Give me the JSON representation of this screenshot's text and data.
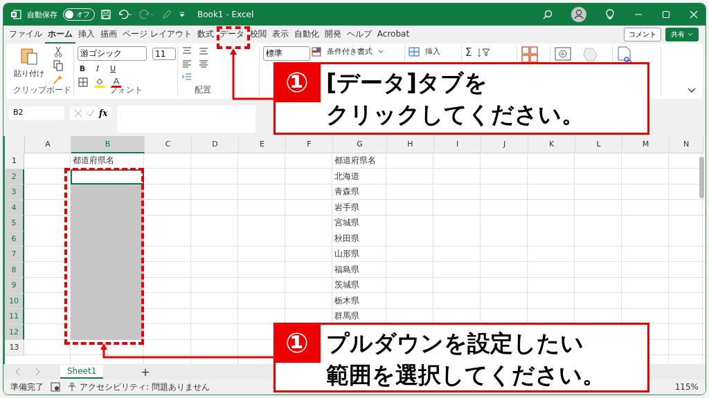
{
  "window": {
    "title": "Book1  -  Excel",
    "autosave_label": "自動保存",
    "autosave_state": "オフ",
    "autosave_on": false
  },
  "ribbon_tabs": [
    {
      "label": "ファイル",
      "selected": false
    },
    {
      "label": "ホーム",
      "selected": true
    },
    {
      "label": "挿入",
      "selected": false
    },
    {
      "label": "描画",
      "selected": false
    },
    {
      "label": "ページ レイアウト",
      "selected": false
    },
    {
      "label": "数式",
      "selected": false
    },
    {
      "label": "データ",
      "selected": false
    },
    {
      "label": "校閲",
      "selected": false
    },
    {
      "label": "表示",
      "selected": false
    },
    {
      "label": "自動化",
      "selected": false
    },
    {
      "label": "開発",
      "selected": false
    },
    {
      "label": "ヘルプ",
      "selected": false
    },
    {
      "label": "Acrobat",
      "selected": false
    }
  ],
  "comment_button": "コメント",
  "share_button": "共有",
  "ribbon": {
    "paste": "貼り付け",
    "clipboard_group": "クリップボード",
    "font_name": "游ゴシック",
    "font_size": "11",
    "bold": "B",
    "italic": "I",
    "underline": "U",
    "font_group": "フォント",
    "alignment_group": "配置",
    "number_format": "標準",
    "conditional_format": "条件付き書式",
    "insert": "挿入",
    "sum": "Σ"
  },
  "name_box": "B2",
  "fx_label": "fx",
  "columns": [
    {
      "label": "A",
      "selected": false
    },
    {
      "label": "B",
      "selected": true
    },
    {
      "label": "C",
      "selected": false
    },
    {
      "label": "D",
      "selected": false
    },
    {
      "label": "E",
      "selected": false
    },
    {
      "label": "F",
      "selected": false
    },
    {
      "label": "G",
      "selected": false
    },
    {
      "label": "H",
      "selected": false
    },
    {
      "label": "I",
      "selected": false
    },
    {
      "label": "J",
      "selected": false
    },
    {
      "label": "K",
      "selected": false
    },
    {
      "label": "L",
      "selected": false
    },
    {
      "label": "M",
      "selected": false
    },
    {
      "label": "N",
      "selected": false
    }
  ],
  "rows": [
    {
      "number": "1",
      "selected": false,
      "active": false,
      "col_b": "都道府県名",
      "col_g": "都道府県名"
    },
    {
      "number": "2",
      "selected": true,
      "active": true,
      "col_g": "北海道"
    },
    {
      "number": "3",
      "selected": true,
      "active": false,
      "col_g": "青森県"
    },
    {
      "number": "4",
      "selected": true,
      "active": false,
      "col_g": "岩手県"
    },
    {
      "number": "5",
      "selected": true,
      "active": false,
      "col_g": "宮城県"
    },
    {
      "number": "6",
      "selected": true,
      "active": false,
      "col_g": "秋田県"
    },
    {
      "number": "7",
      "selected": true,
      "active": false,
      "col_g": "山形県"
    },
    {
      "number": "8",
      "selected": true,
      "active": false,
      "col_g": "福島県"
    },
    {
      "number": "9",
      "selected": true,
      "active": false,
      "col_g": "茨城県"
    },
    {
      "number": "10",
      "selected": true,
      "active": false,
      "col_g": "栃木県"
    },
    {
      "number": "11",
      "selected": true,
      "active": false,
      "col_g": "群馬県"
    },
    {
      "number": "12",
      "selected": true,
      "active": false
    },
    {
      "number": "13",
      "selected": false,
      "active": false
    }
  ],
  "sheet_tabs": [
    {
      "label": "Sheet1",
      "selected": true
    }
  ],
  "add_sheet": "+",
  "status_bar": {
    "ready": "準備完了",
    "accessibility": "アクセシビリティ: 問題ありません",
    "zoom": "115%"
  },
  "callouts": [
    {
      "badge": "①",
      "lines": [
        "[データ]タブを",
        "クリックしてください。"
      ]
    },
    {
      "badge": "①",
      "lines": [
        "プルダウンを設定したい",
        "範囲を選択してください。"
      ]
    }
  ]
}
